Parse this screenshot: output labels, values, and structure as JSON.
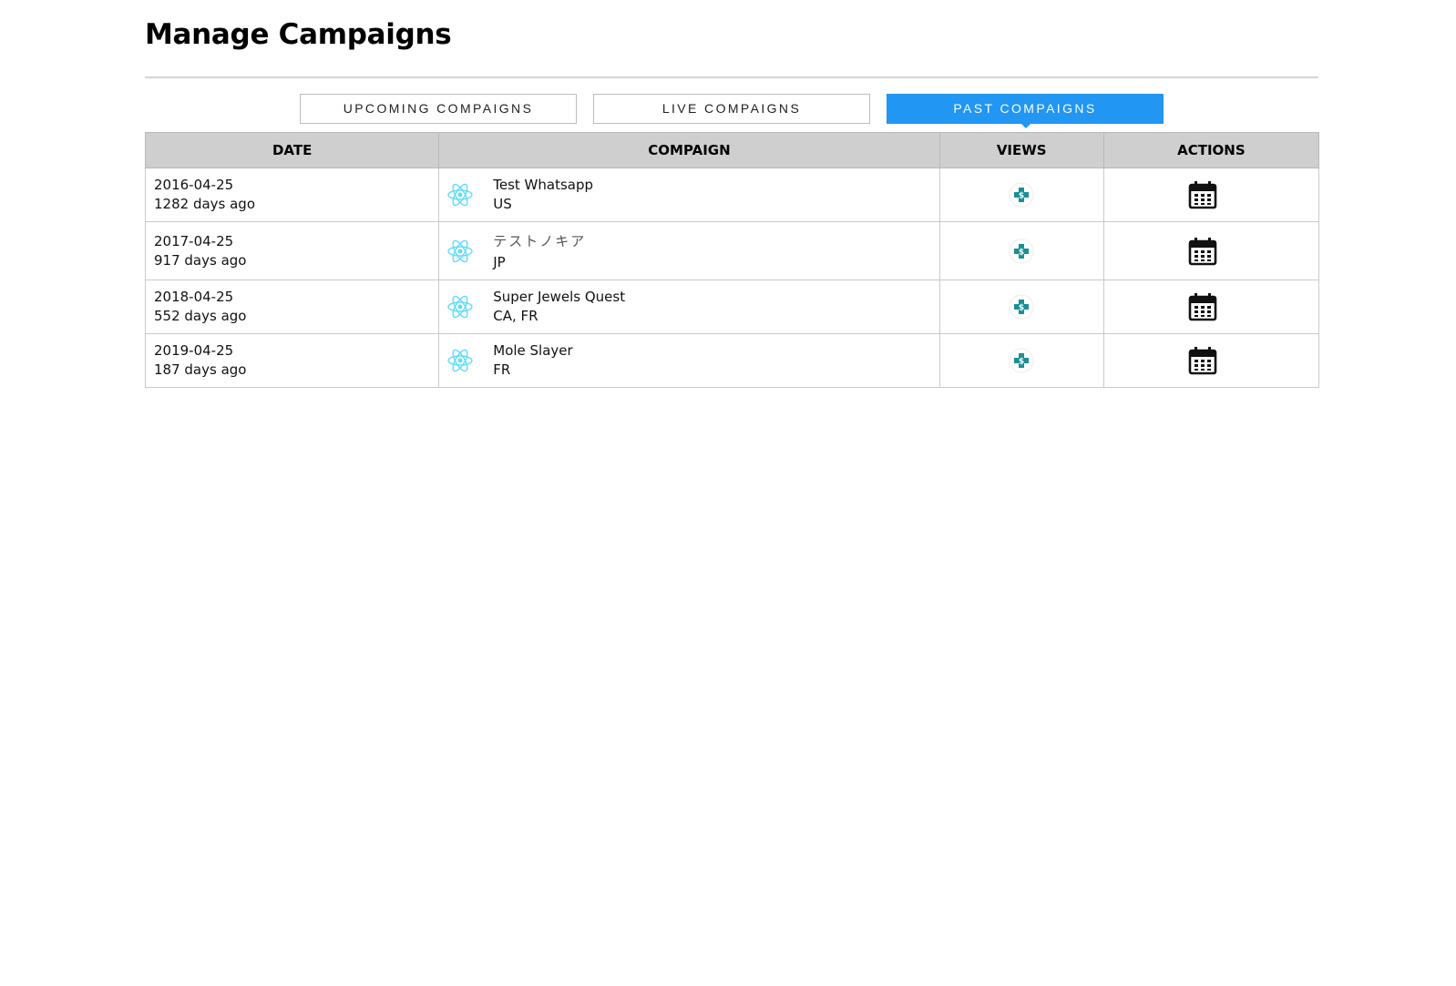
{
  "header": {
    "title": "Manage Campaigns"
  },
  "tabs": [
    {
      "label": "UPCOMING COMPAIGNS",
      "active": false
    },
    {
      "label": "LIVE COMPAIGNS",
      "active": false
    },
    {
      "label": "PAST COMPAIGNS",
      "active": true
    }
  ],
  "table": {
    "columns": [
      "DATE",
      "COMPAIGN",
      "VIEWS",
      "ACTIONS"
    ],
    "rows": [
      {
        "date": "2016-04-25",
        "ago": "1282 days ago",
        "name": "Test Whatsapp",
        "region": "US",
        "logo_icon": "react-atom-icon",
        "views_icon": "price-tag-icon",
        "action_icon": "calendar-icon"
      },
      {
        "date": "2017-04-25",
        "ago": "917 days ago",
        "name": "テストノキア",
        "region": "JP",
        "logo_icon": "react-atom-icon",
        "views_icon": "price-tag-icon",
        "action_icon": "calendar-icon"
      },
      {
        "date": "2018-04-25",
        "ago": "552 days ago",
        "name": "Super Jewels Quest",
        "region": "CA, FR",
        "logo_icon": "react-atom-icon",
        "views_icon": "price-tag-icon",
        "action_icon": "calendar-icon"
      },
      {
        "date": "2019-04-25",
        "ago": "187 days ago",
        "name": "Mole Slayer",
        "region": "FR",
        "logo_icon": "react-atom-icon",
        "views_icon": "price-tag-icon",
        "action_icon": "calendar-icon"
      }
    ]
  },
  "colors": {
    "accent": "#2196f3",
    "header_bg": "#cfcfcf",
    "logo": "#61dafb",
    "views_icon": "#1a8f94"
  }
}
